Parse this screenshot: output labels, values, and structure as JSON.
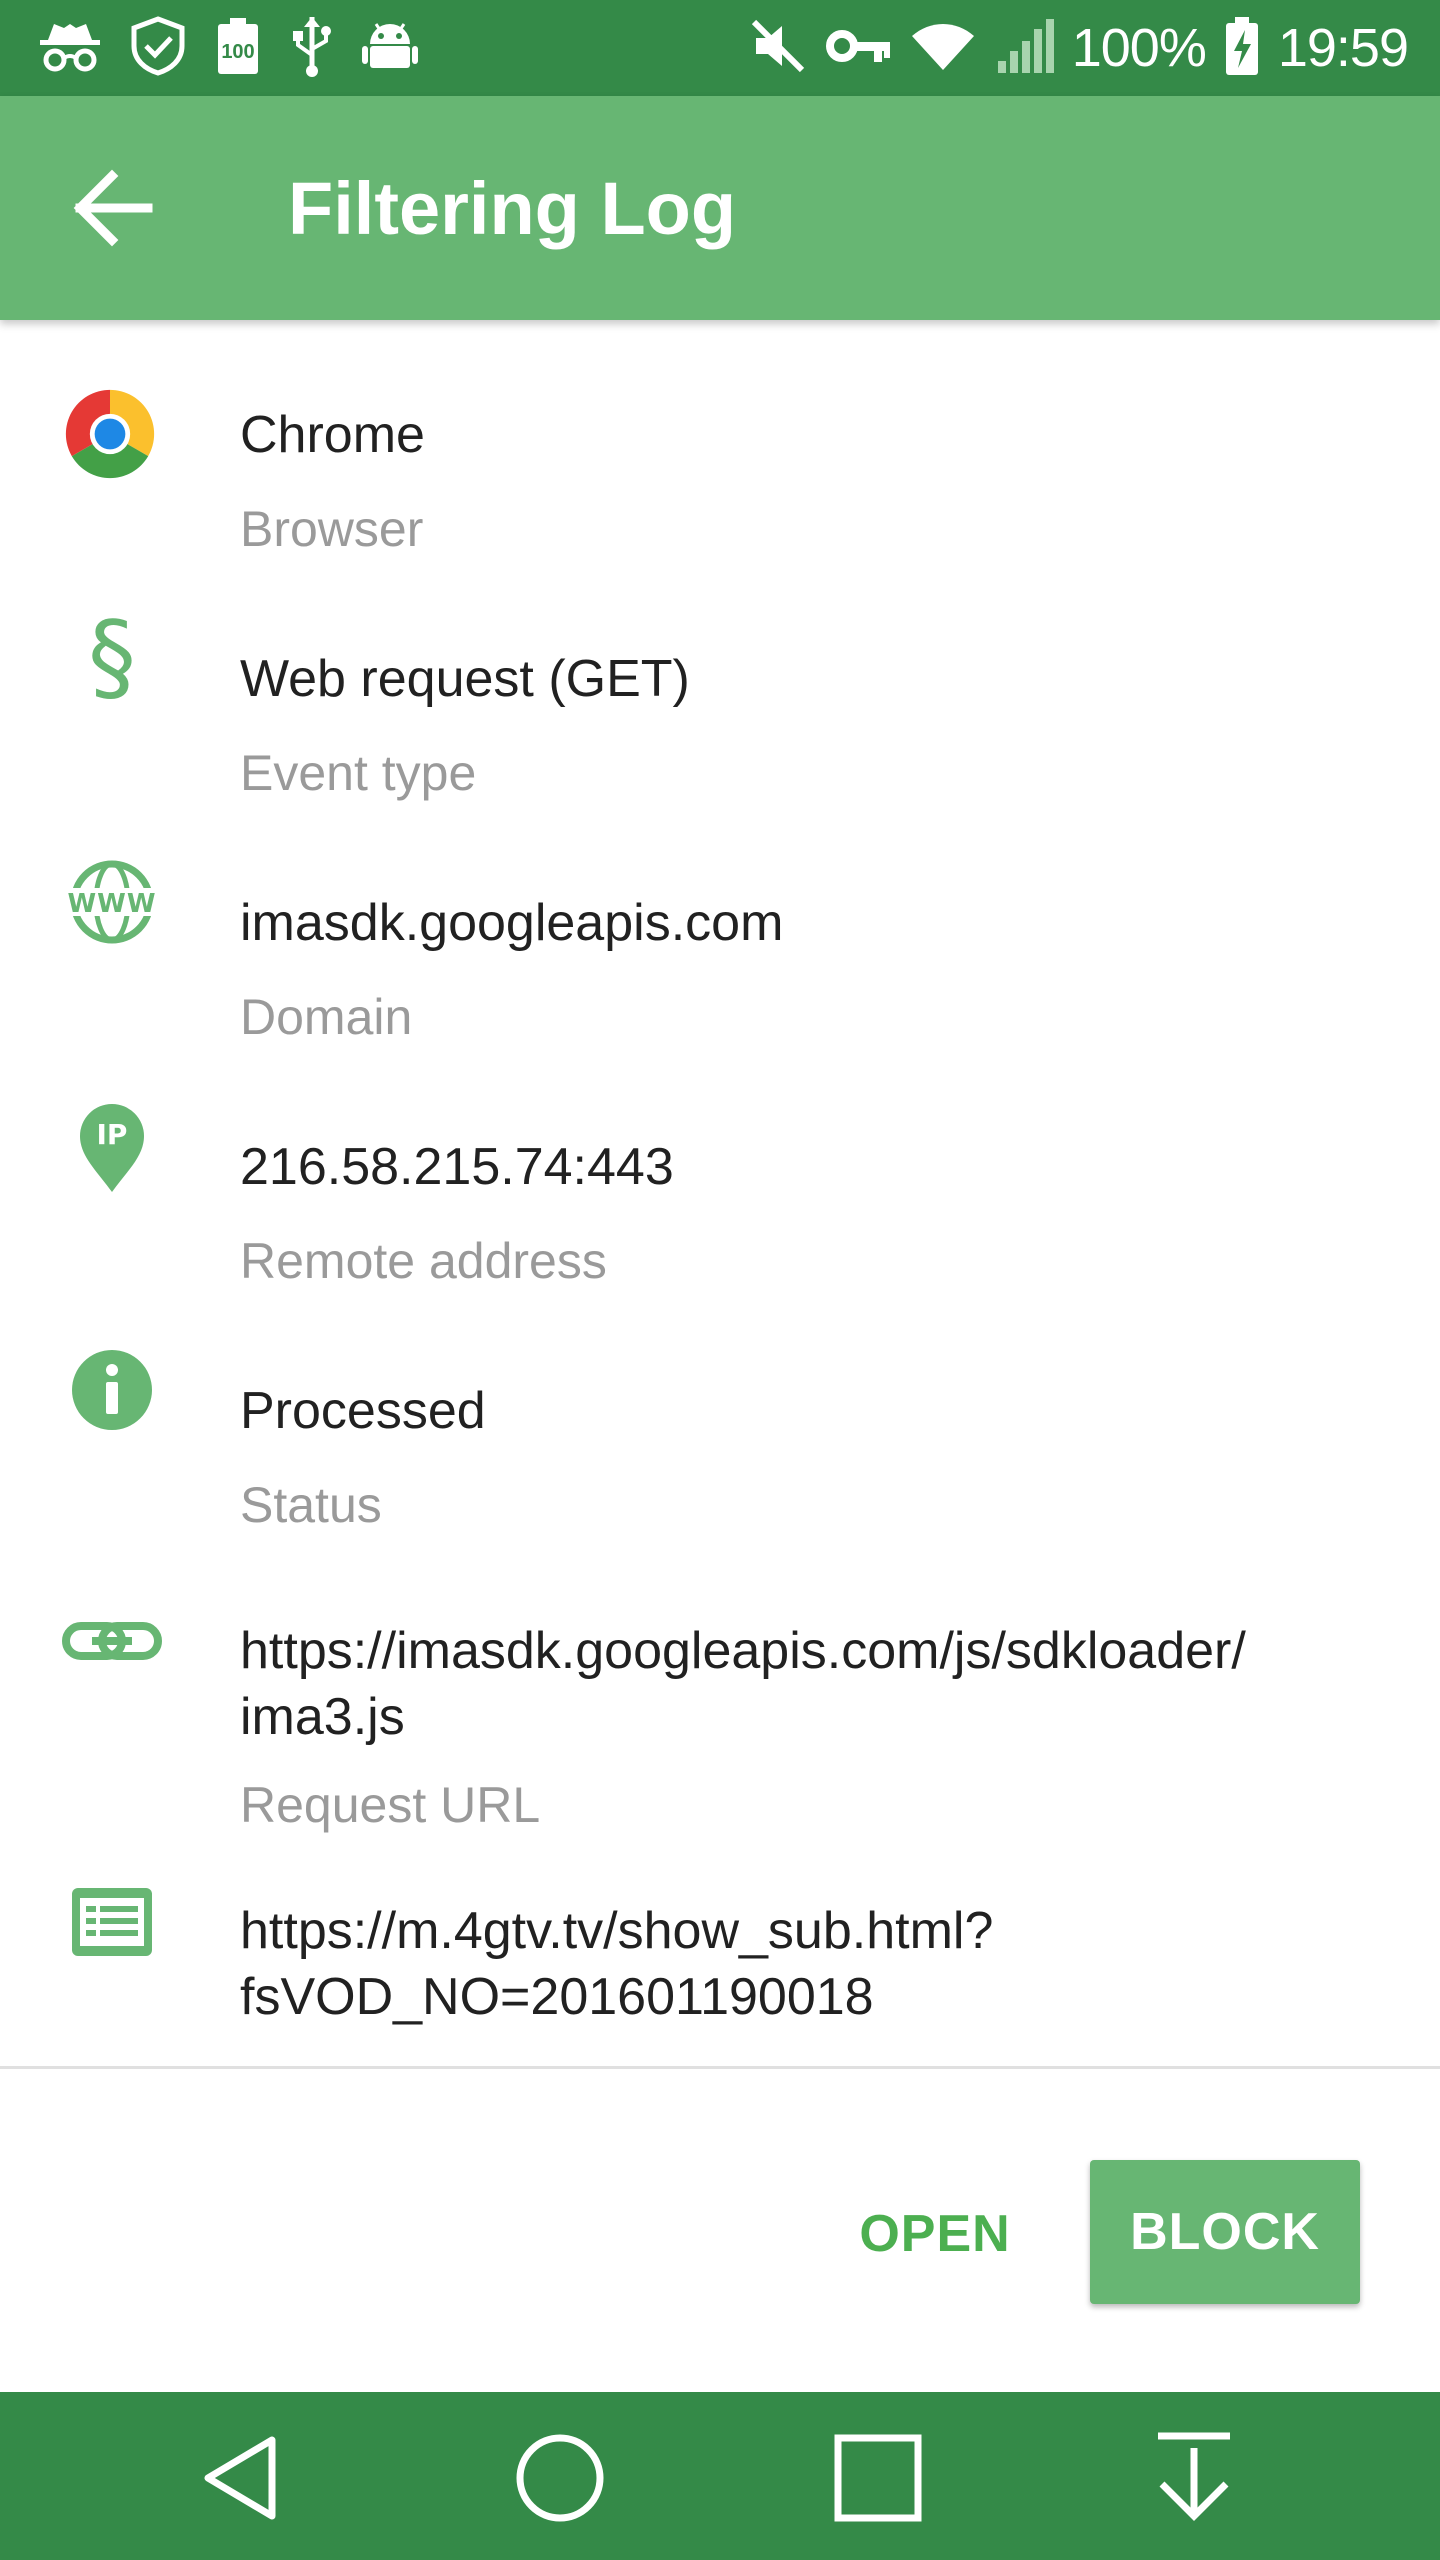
{
  "status_bar": {
    "battery_text": "100%",
    "time": "19:59",
    "icons": [
      "incognito-icon",
      "shield-check-icon",
      "battery-100-icon",
      "usb-icon",
      "android-icon",
      "muted-icon",
      "vpn-key-icon",
      "wifi-icon",
      "signal-icon",
      "battery-charging-icon"
    ]
  },
  "app_bar": {
    "title": "Filtering Log",
    "back_icon": "arrow-back-icon"
  },
  "details": [
    {
      "icon": "chrome-icon",
      "value": "Chrome",
      "label": "Browser"
    },
    {
      "icon": "section-icon",
      "value": "Web request (GET)",
      "label": "Event type"
    },
    {
      "icon": "www-globe-icon",
      "value": "imasdk.googleapis.com",
      "label": "Domain"
    },
    {
      "icon": "ip-pin-icon",
      "value": "216.58.215.74:443",
      "label": "Remote address"
    },
    {
      "icon": "info-icon",
      "value": "Processed",
      "label": "Status"
    },
    {
      "icon": "link-icon",
      "value_line1": "https://imasdk.googleapis.com/js/sdkloader/",
      "value_line2": "ima3.js",
      "label": "Request URL"
    },
    {
      "icon": "list-doc-icon",
      "value_line1": "https://m.4gtv.tv/show_sub.html?",
      "value_line2": "fsVOD_NO=201601190018"
    }
  ],
  "actions": {
    "open_label": "OPEN",
    "block_label": "BLOCK"
  },
  "colors": {
    "status_bar": "#348a48",
    "app_bar": "#67b673",
    "accent": "#4caf50",
    "nav_bar": "#348a48"
  }
}
